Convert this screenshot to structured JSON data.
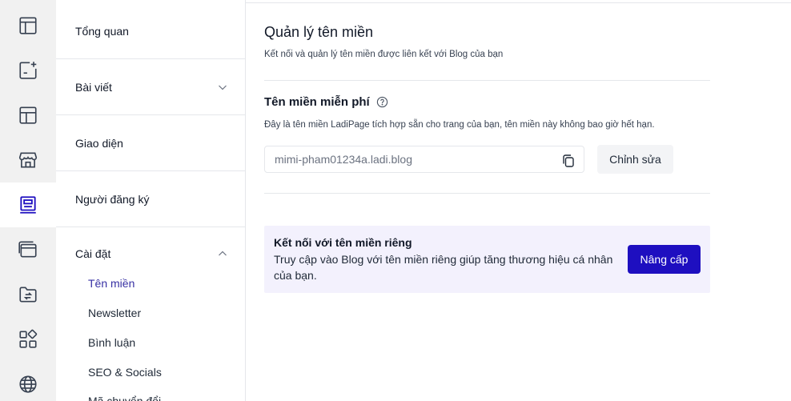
{
  "rail": {
    "items": [
      {
        "icon": "layout-icon",
        "active": false
      },
      {
        "icon": "add-post-icon",
        "active": false
      },
      {
        "icon": "template-icon",
        "active": false
      },
      {
        "icon": "store-icon",
        "active": false
      },
      {
        "icon": "blog-icon",
        "active": true
      },
      {
        "icon": "browser-window-icon",
        "active": false
      },
      {
        "icon": "folder-sync-icon",
        "active": false
      },
      {
        "icon": "apps-icon",
        "active": false
      },
      {
        "icon": "globe-icon",
        "active": false
      }
    ],
    "accent_color": "#1e0fc0"
  },
  "nav": {
    "sections": [
      {
        "label": "Tổng quan"
      },
      {
        "label": "Bài viết"
      },
      {
        "label": "Giao diện"
      },
      {
        "label": "Người đăng ký"
      }
    ],
    "settings": {
      "label": "Cài đặt",
      "items": [
        {
          "label": "Tên miền",
          "active": true
        },
        {
          "label": "Newsletter"
        },
        {
          "label": "Bình luận"
        },
        {
          "label": "SEO & Socials"
        },
        {
          "label": "Mã chuyển đổi"
        }
      ]
    }
  },
  "main": {
    "title": "Quản lý tên miền",
    "description": "Kết nối và quản lý tên miền được liên kết với Blog của bạn",
    "free_domain": {
      "title": "Tên miền miễn phí",
      "description": "Đây là tên miền LadiPage tích hợp sẵn cho trang của bạn, tên miền này không bao giờ hết hạn.",
      "value": "mimi-pham01234a.ladi.blog",
      "edit_label": "Chỉnh sửa"
    },
    "promo": {
      "title": "Kết nối với tên miền riêng",
      "description": "Truy cập vào Blog với tên miền riêng giúp tăng thương hiệu cá nhân của bạn.",
      "button_label": "Nâng cấp",
      "background": "#f3f1fd",
      "button_color": "#1e0fc0"
    }
  }
}
